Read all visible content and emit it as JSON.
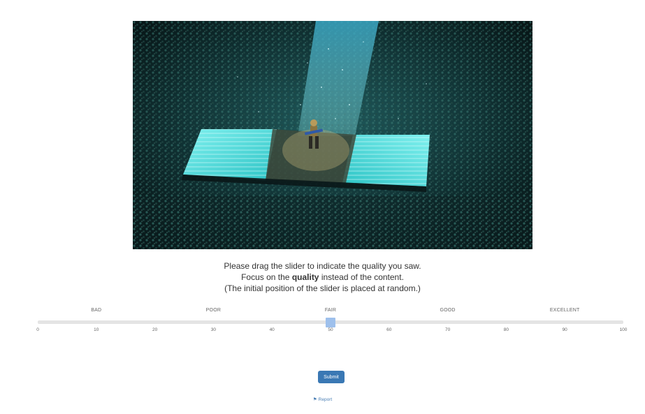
{
  "stimulus": {
    "description_icon": "concert-photo"
  },
  "instructions": {
    "line1": "Please drag the slider to indicate the quality you saw.",
    "line2_prefix": "Focus on the ",
    "line2_bold": "quality",
    "line2_suffix": " instead of the content.",
    "line3": "(The initial position of the slider is placed at random.)"
  },
  "slider": {
    "min": 0,
    "max": 100,
    "value": 50,
    "handle_color": "#9ec0ec",
    "track_color": "#e4e4e4",
    "scale_labels": [
      {
        "label": "BAD",
        "at": 10
      },
      {
        "label": "POOR",
        "at": 30
      },
      {
        "label": "FAIR",
        "at": 50
      },
      {
        "label": "GOOD",
        "at": 70
      },
      {
        "label": "EXCELLENT",
        "at": 90
      }
    ],
    "ticks": [
      "0",
      "10",
      "20",
      "30",
      "40",
      "50",
      "60",
      "70",
      "80",
      "90",
      "100"
    ]
  },
  "submit": {
    "label": "Submit",
    "color": "#3a78b4"
  },
  "report": {
    "icon": "flag-icon",
    "label": "Report",
    "color": "#4a7fb5"
  }
}
